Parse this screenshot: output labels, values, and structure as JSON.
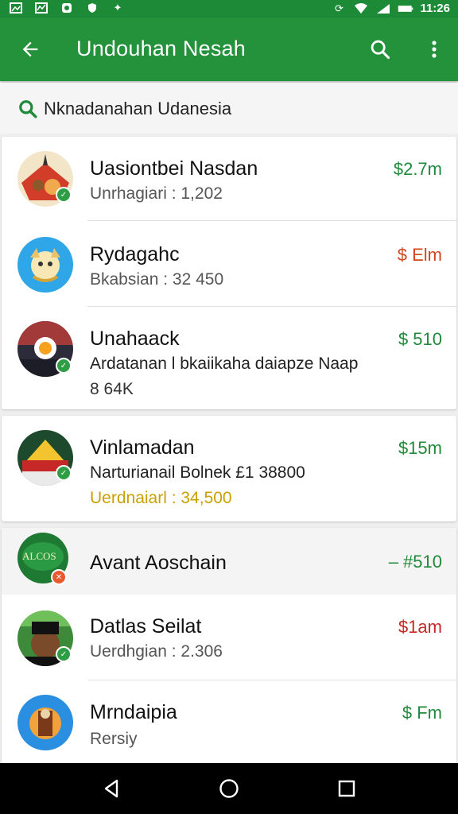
{
  "status_bar": {
    "time": "11:26"
  },
  "app_bar": {
    "title": "Undouhan Nesah"
  },
  "search": {
    "query": "Nknadanahan Udanesia"
  },
  "items": [
    {
      "name": "Uasiontbei Nasdan",
      "subtitle": "Unrhagiari : 1,202",
      "price": "$2.7m",
      "price_color": "#1f8a3a"
    },
    {
      "name": "Rydagahc",
      "subtitle": "Bkabsian : 32 450",
      "price": "$ Elm",
      "price_color": "#d2451e"
    },
    {
      "name": "Unahaack",
      "subtitle": "Ardatanan l bkaiikaha daiapze Naap",
      "subtitle2": "8 64K",
      "price": "$ 510",
      "price_color": "#1f8a3a"
    },
    {
      "name": "Vinlamadan",
      "subtitle": "Narturianail Bolnek £1 38800",
      "subtitle2": "Uerdnaiarl : 34,500",
      "subtitle2_color": "#c9a000",
      "price": "$15m",
      "price_color": "#1f8a3a"
    },
    {
      "name": "Avant Aoschain",
      "price": "– #510",
      "price_color": "#1f8a3a",
      "logo_text": "ALCOS"
    },
    {
      "name": "Datlas Seilat",
      "subtitle": "Uerdhgian : 2.306",
      "price": "$1am",
      "price_color": "#c62828"
    },
    {
      "name": "Mrndaipia",
      "subtitle": "Rersiy",
      "price": "$ Fm",
      "price_color": "#1f8a3a"
    }
  ]
}
